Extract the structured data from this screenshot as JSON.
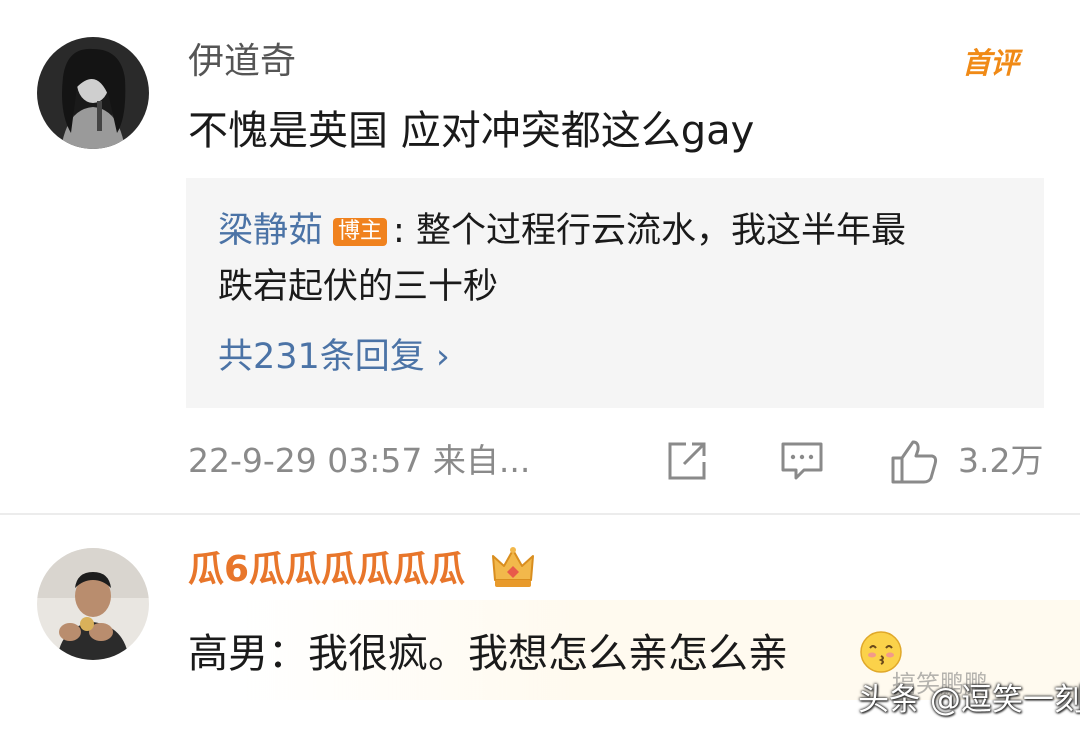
{
  "comments": [
    {
      "username": "伊道奇",
      "badge": "首评",
      "text": "不愧是英国 应对冲突都这么gay",
      "reply": {
        "author": "梁静茹",
        "author_badge": "博主",
        "line1": ": 整个过程行云流水，我这半年最",
        "line2": "跌宕起伏的三十秒",
        "count_label": "共231条回复 ›"
      },
      "meta": "22-9-29 03:57  来自...",
      "likes": "3.2万",
      "icons": [
        "share-icon",
        "comment-icon",
        "like-icon"
      ]
    },
    {
      "username": "瓜6瓜瓜瓜瓜瓜瓜",
      "text": "高男：我很疯。我想怎么亲怎么亲",
      "icons": [
        "crown-icon",
        "kissing-emoji"
      ]
    }
  ],
  "watermarks": {
    "faint": "搞笑鹏鹏",
    "main": "头条 @逗笑一刻"
  },
  "colors": {
    "link_blue": "#4b73a6",
    "vip_orange": "#e8762b",
    "badge_orange": "#f0821e",
    "meta_gray": "#8a8a8a",
    "reply_bg": "#f5f5f5"
  }
}
